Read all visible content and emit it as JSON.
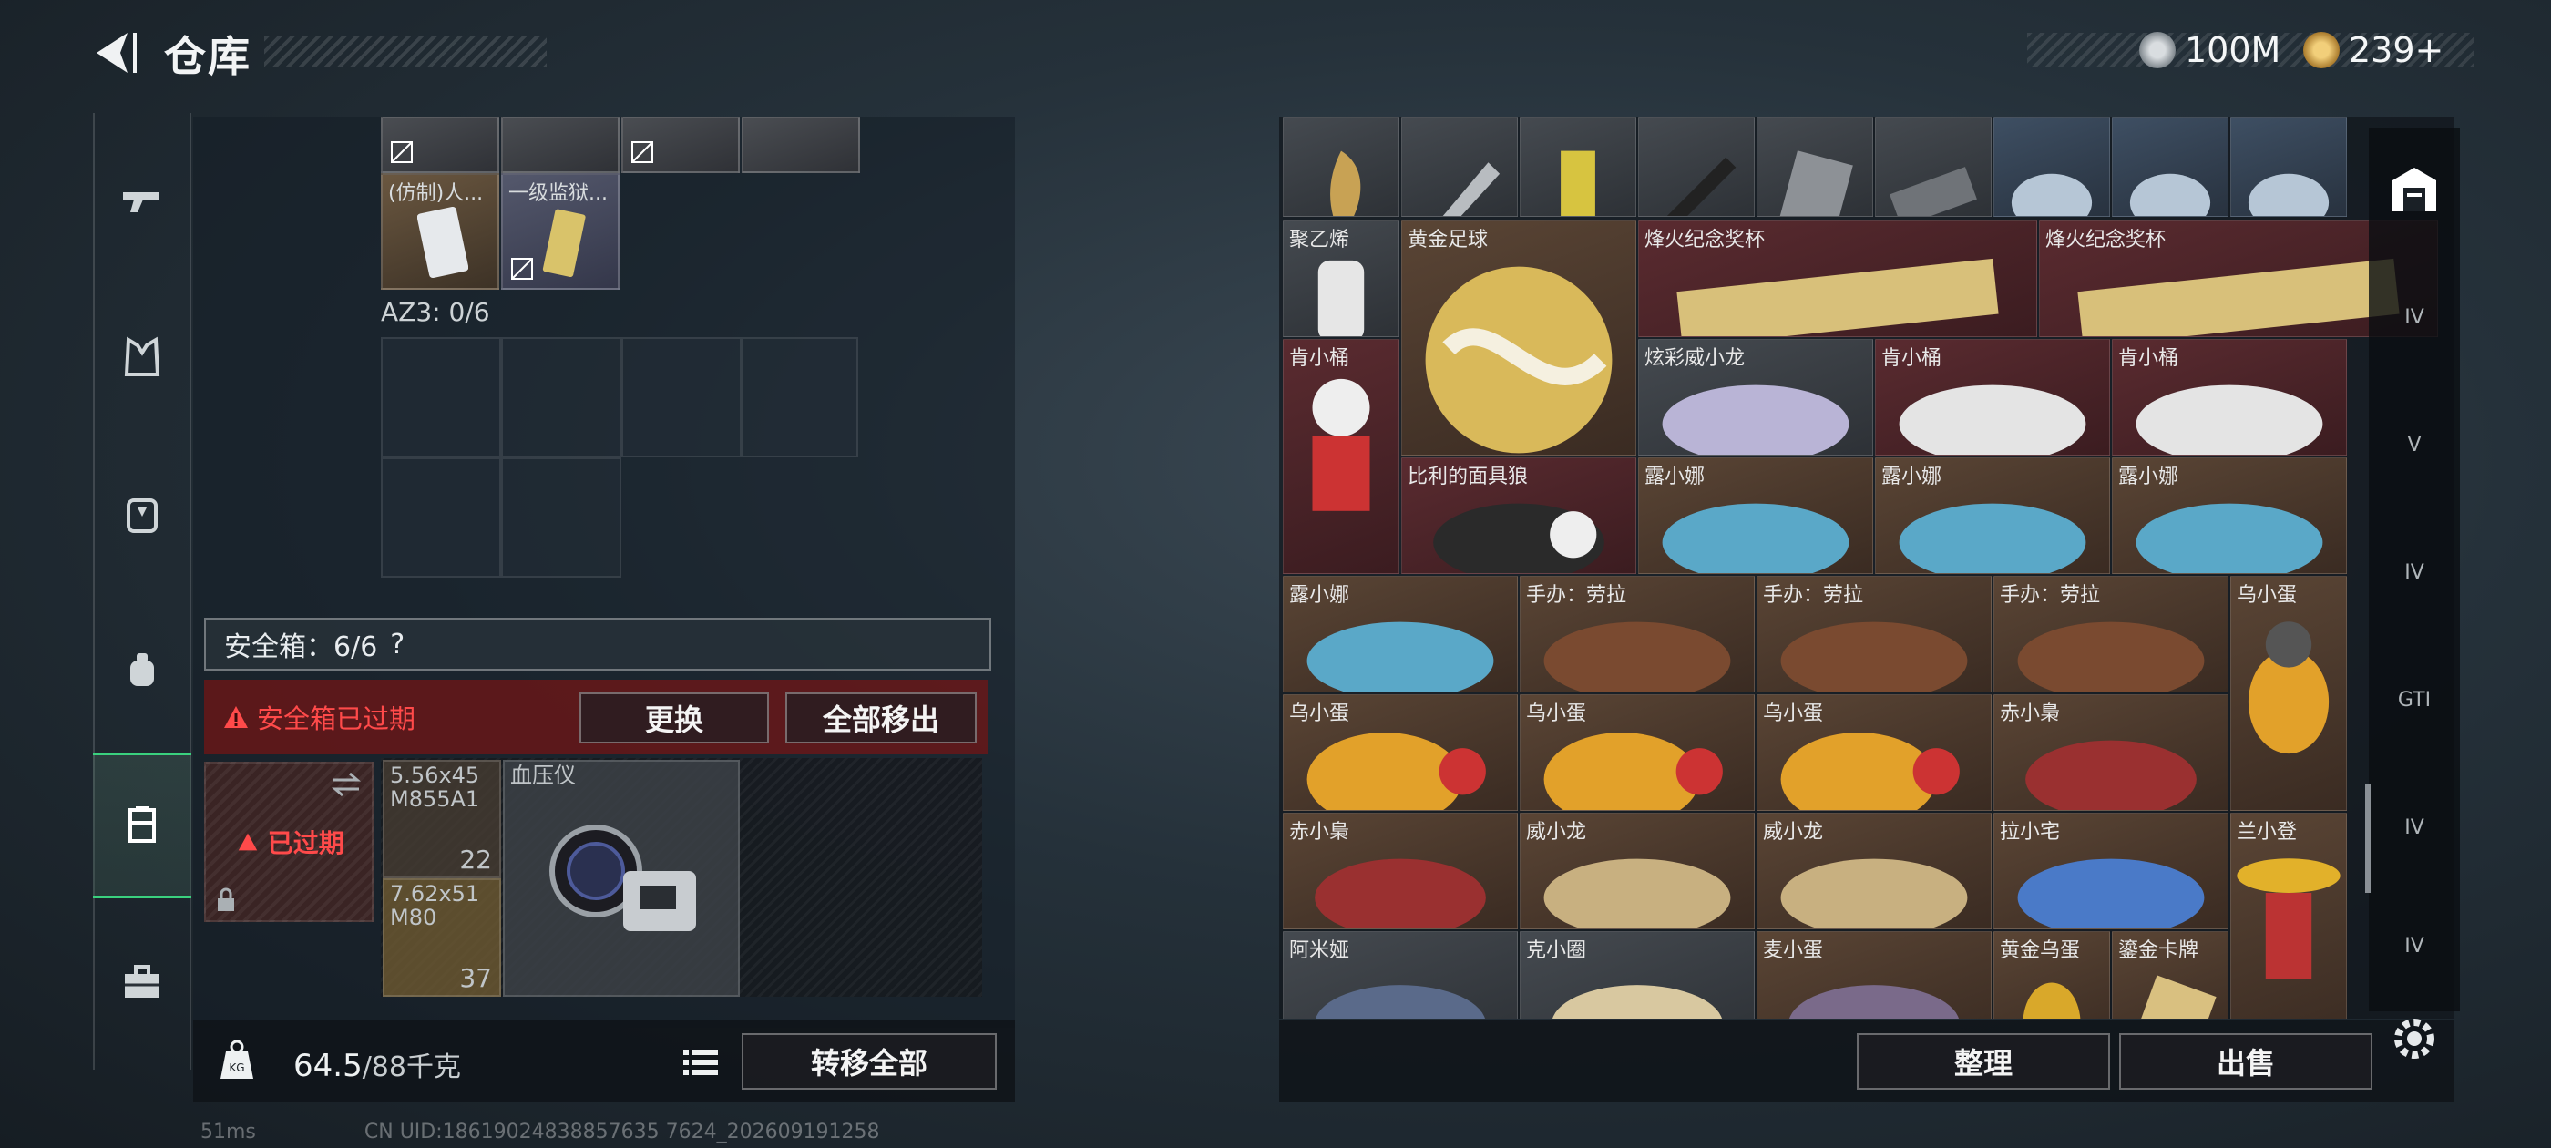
{
  "header": {
    "title": "仓库",
    "currency1": "100M",
    "currency2": "239+"
  },
  "safebox": {
    "bar_label": "安全箱：6/6",
    "help": "?",
    "expired_notice": "安全箱已过期",
    "replace_btn": "更换",
    "move_all_out_btn": "全部移出",
    "slot_expired": "已过期"
  },
  "container": {
    "items": [
      {
        "name": "(仿制)人..."
      },
      {
        "name": "一级监狱..."
      }
    ],
    "az3_label": "AZ3: 0/6"
  },
  "safebox_items": [
    {
      "label": "5.56x45 M855A1",
      "count": "22"
    },
    {
      "label": "7.62x51 M80",
      "count": "37"
    },
    {
      "label": "血压仪",
      "count": ""
    }
  ],
  "weight": {
    "current": "64.5",
    "max": "/88千克"
  },
  "transfer_all_btn": "转移全部",
  "warehouse": {
    "items": [
      "聚乙烯",
      "黄金足球",
      "烽火纪念奖杯",
      "烽火纪念奖杯",
      "肯小桶",
      "炫彩威小龙",
      "肯小桶",
      "肯小桶",
      "比利的面具狼",
      "露小娜",
      "露小娜",
      "露小娜",
      "露小娜",
      "手办：劳拉",
      "手办：劳拉",
      "手办：劳拉",
      "乌小蛋",
      "乌小蛋",
      "乌小蛋",
      "乌小蛋",
      "赤小梟",
      "赤小梟",
      "威小龙",
      "威小龙",
      "拉小宅",
      "兰小登",
      "阿米娅",
      "克小圈",
      "麦小蛋",
      "黄金乌蛋",
      "鎏金卡牌"
    ]
  },
  "right_buttons": {
    "sort": "整理",
    "sell": "出售"
  },
  "side_tags": [
    "IV",
    "V",
    "IV",
    "GTI",
    "IV",
    "IV"
  ],
  "footer": {
    "ping": "51ms",
    "uid": "CN UID:18619024838857635 7624_202609191258"
  }
}
